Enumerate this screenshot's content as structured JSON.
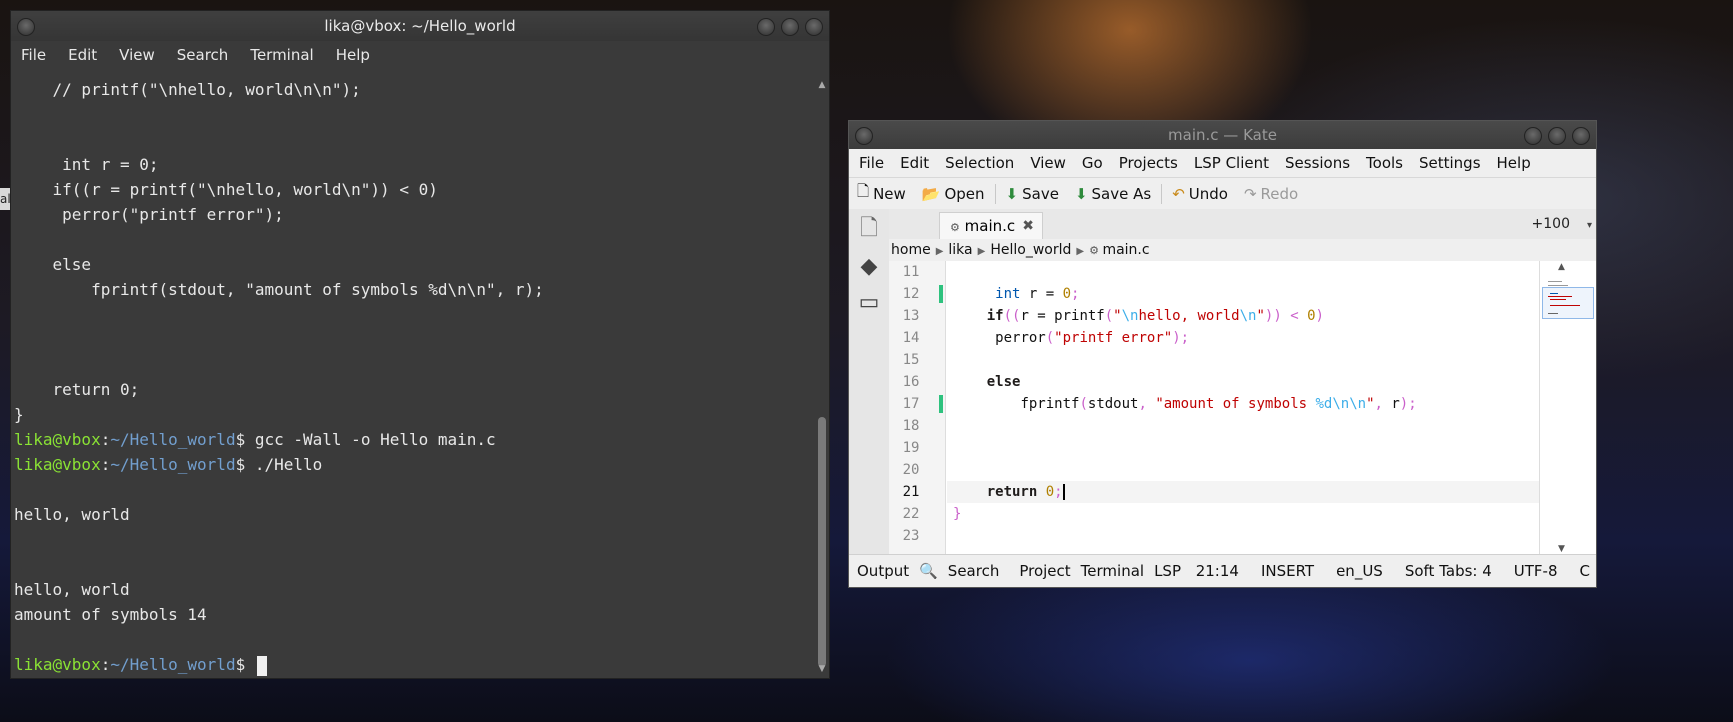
{
  "terminal": {
    "title": "lika@vbox: ~/Hello_world",
    "menu": [
      "File",
      "Edit",
      "View",
      "Search",
      "Terminal",
      "Help"
    ],
    "lines": [
      "    // printf(\"\\nhello, world\\n\\n\");",
      "",
      "",
      "     int r = 0;",
      "    if((r = printf(\"\\nhello, world\\n\")) < 0)",
      "     perror(\"printf error\");",
      "",
      "    else",
      "        fprintf(stdout, \"amount of symbols %d\\n\\n\", r);",
      "",
      "",
      "",
      "    return 0;",
      "}"
    ],
    "prompt_user": "lika@vbox",
    "prompt_sep": ":",
    "prompt_path": "~/Hello_world",
    "prompt_symbol": "$",
    "cmd1": " gcc -Wall -o Hello main.c",
    "cmd2": " ./Hello",
    "output": [
      "",
      "hello, world",
      "",
      "",
      "hello, world",
      "amount of symbols 14",
      ""
    ],
    "cmd3": " "
  },
  "left_edge_label": "al",
  "kate": {
    "title": "main.c — Kate",
    "menu": [
      "File",
      "Edit",
      "Selection",
      "View",
      "Go",
      "Projects",
      "LSP Client",
      "Sessions",
      "Tools",
      "Settings",
      "Help"
    ],
    "toolbar": {
      "new": "New",
      "open": "Open",
      "save": "Save",
      "save_as": "Save As",
      "undo": "Undo",
      "redo": "Redo"
    },
    "tab": {
      "label": "main.c",
      "plus": "+100"
    },
    "breadcrumb": [
      "home",
      "lika",
      "Hello_world",
      "main.c"
    ],
    "line_numbers": [
      "11",
      "12",
      "13",
      "14",
      "15",
      "16",
      "17",
      "18",
      "19",
      "20",
      "21",
      "22",
      "23"
    ],
    "active_line": "21",
    "status": {
      "output": "Output",
      "search": "Search",
      "project": "Project",
      "terminal": "Terminal",
      "lsp": "LSP",
      "position": "21:14",
      "mode": "INSERT",
      "lang": "en_US",
      "tabs": "Soft Tabs: 4",
      "encoding": "UTF-8",
      "syntax": "C"
    },
    "code": {
      "l12_kw": "int",
      "l12_rest": " r = ",
      "l12_num": "0",
      "l12_end": ";",
      "l13_kw": "if",
      "l13_a": "((",
      "l13_b": "r = printf",
      "l13_c": "(",
      "l13_q1": "\"",
      "l13_esc1": "\\n",
      "l13_s": "hello, world",
      "l13_esc2": "\\n",
      "l13_q2": "\"",
      "l13_d": ")) < ",
      "l13_num": "0",
      "l13_e": ")",
      "l14_fn": "perror",
      "l14_p1": "(",
      "l14_s": "\"printf error\"",
      "l14_p2": ");",
      "l16_kw": "else",
      "l17_fn": "fprintf",
      "l17_p1": "(",
      "l17_arg": "stdout",
      "l17_c": ", ",
      "l17_s1": "\"amount of symbols ",
      "l17_esc": "%d\\n\\n",
      "l17_s2": "\"",
      "l17_c2": ", ",
      "l17_r": "r",
      "l17_p2": ");",
      "l21_kw": "return",
      "l21_num": "0",
      "l21_end": ";",
      "l22": "}"
    }
  }
}
